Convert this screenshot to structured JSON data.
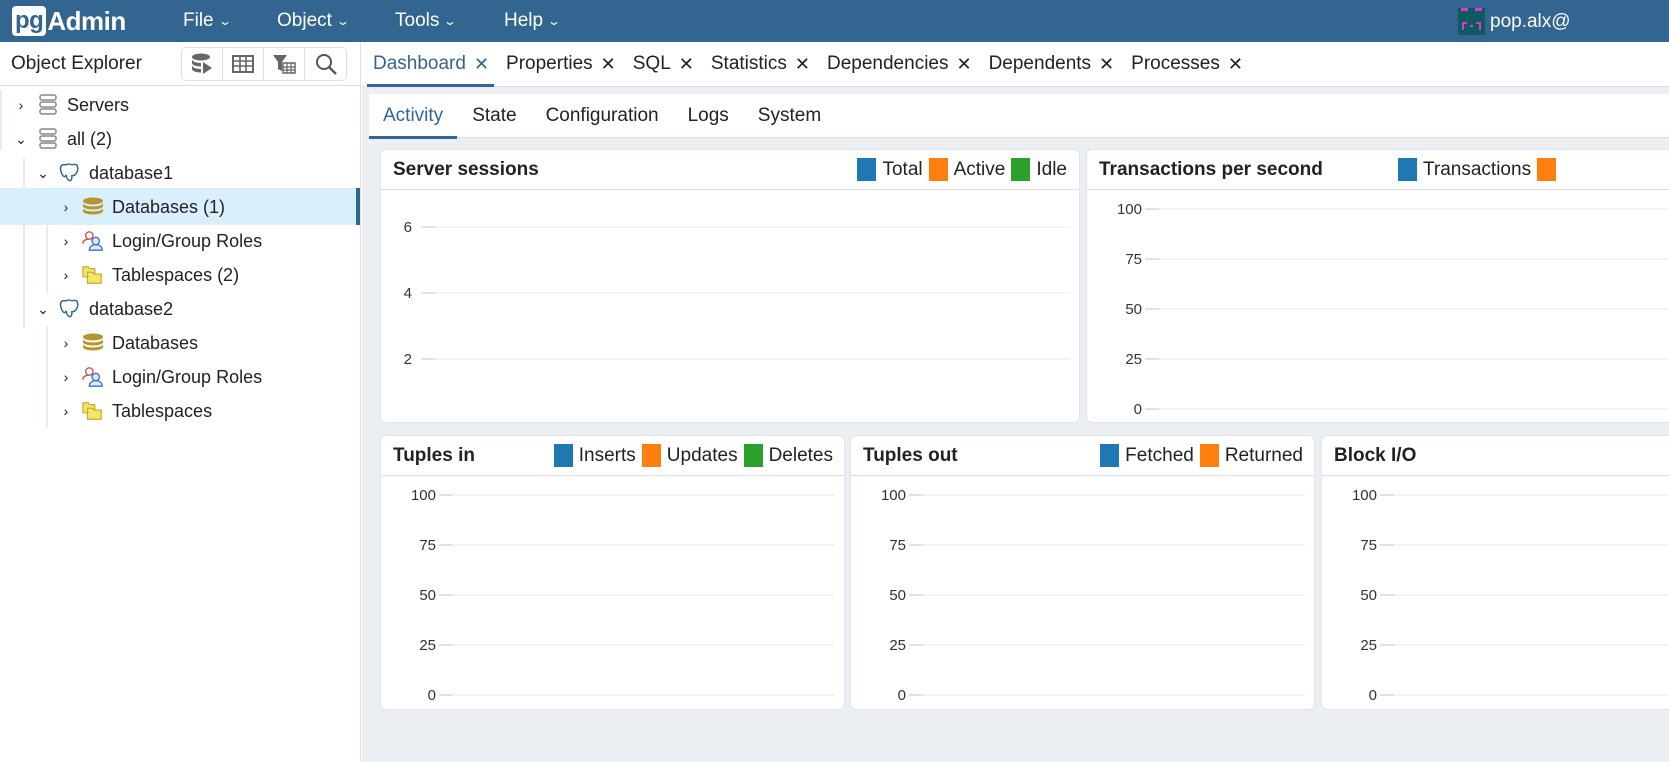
{
  "app": {
    "logo_pg": "pg",
    "logo_admin": "Admin",
    "user": "pop.alx@"
  },
  "menu": [
    {
      "label": "File"
    },
    {
      "label": "Object"
    },
    {
      "label": "Tools"
    },
    {
      "label": "Help"
    }
  ],
  "explorer": {
    "title": "Object Explorer",
    "toolbar": [
      "query-tool-icon",
      "view-data-icon",
      "filtered-rows-icon",
      "search-icon"
    ],
    "tree": [
      {
        "label": "Servers",
        "expanded": false,
        "icon": "server-group-icon"
      },
      {
        "label": "all (2)",
        "expanded": true,
        "icon": "server-group-icon"
      },
      {
        "label": "database1",
        "expanded": true,
        "icon": "postgres-server-icon"
      },
      {
        "label": "Databases (1)",
        "expanded": false,
        "icon": "databases-icon",
        "selected": true
      },
      {
        "label": "Login/Group Roles",
        "expanded": false,
        "icon": "roles-icon"
      },
      {
        "label": "Tablespaces (2)",
        "expanded": false,
        "icon": "tablespaces-icon"
      },
      {
        "label": "database2",
        "expanded": true,
        "icon": "postgres-server-icon"
      },
      {
        "label": "Databases",
        "expanded": false,
        "icon": "databases-icon"
      },
      {
        "label": "Login/Group Roles",
        "expanded": false,
        "icon": "roles-icon"
      },
      {
        "label": "Tablespaces",
        "expanded": false,
        "icon": "tablespaces-icon"
      }
    ]
  },
  "tabs": [
    {
      "label": "Dashboard",
      "active": true
    },
    {
      "label": "Properties"
    },
    {
      "label": "SQL"
    },
    {
      "label": "Statistics"
    },
    {
      "label": "Dependencies"
    },
    {
      "label": "Dependents"
    },
    {
      "label": "Processes"
    }
  ],
  "subtabs": [
    {
      "label": "Activity",
      "active": true
    },
    {
      "label": "State"
    },
    {
      "label": "Configuration"
    },
    {
      "label": "Logs"
    },
    {
      "label": "System"
    }
  ],
  "colors": {
    "accent": "#326690",
    "blue": "#1f77b4",
    "orange": "#ff7f0e",
    "green": "#2ca02c"
  },
  "chart_data": [
    {
      "type": "line",
      "title": "Server sessions",
      "series": [
        {
          "name": "Total",
          "color": "#1f77b4",
          "values": []
        },
        {
          "name": "Active",
          "color": "#ff7f0e",
          "values": []
        },
        {
          "name": "Idle",
          "color": "#2ca02c",
          "values": []
        }
      ],
      "yticks": [
        "6",
        "4",
        "2"
      ],
      "grid": true,
      "legend": "top-right"
    },
    {
      "type": "line",
      "title": "Transactions per second",
      "series": [
        {
          "name": "Transactions",
          "color": "#1f77b4",
          "values": []
        },
        {
          "name": "",
          "color": "#ff7f0e",
          "values": []
        }
      ],
      "yticks": [
        "100",
        "75",
        "50",
        "25",
        "0"
      ],
      "ylim": [
        0,
        100
      ],
      "grid": true,
      "legend": "top-right"
    },
    {
      "type": "line",
      "title": "Tuples in",
      "series": [
        {
          "name": "Inserts",
          "color": "#1f77b4",
          "values": []
        },
        {
          "name": "Updates",
          "color": "#ff7f0e",
          "values": []
        },
        {
          "name": "Deletes",
          "color": "#2ca02c",
          "values": []
        }
      ],
      "yticks": [
        "100",
        "75",
        "50",
        "25",
        "0"
      ],
      "ylim": [
        0,
        100
      ],
      "grid": true,
      "legend": "top-right"
    },
    {
      "type": "line",
      "title": "Tuples out",
      "series": [
        {
          "name": "Fetched",
          "color": "#1f77b4",
          "values": []
        },
        {
          "name": "Returned",
          "color": "#ff7f0e",
          "values": []
        }
      ],
      "yticks": [
        "100",
        "75",
        "50",
        "25",
        "0"
      ],
      "ylim": [
        0,
        100
      ],
      "grid": true,
      "legend": "top-right"
    },
    {
      "type": "line",
      "title": "Block I/O",
      "series": [],
      "yticks": [
        "100",
        "75",
        "50",
        "25",
        "0"
      ],
      "ylim": [
        0,
        100
      ],
      "grid": true,
      "legend": "top-right"
    }
  ]
}
